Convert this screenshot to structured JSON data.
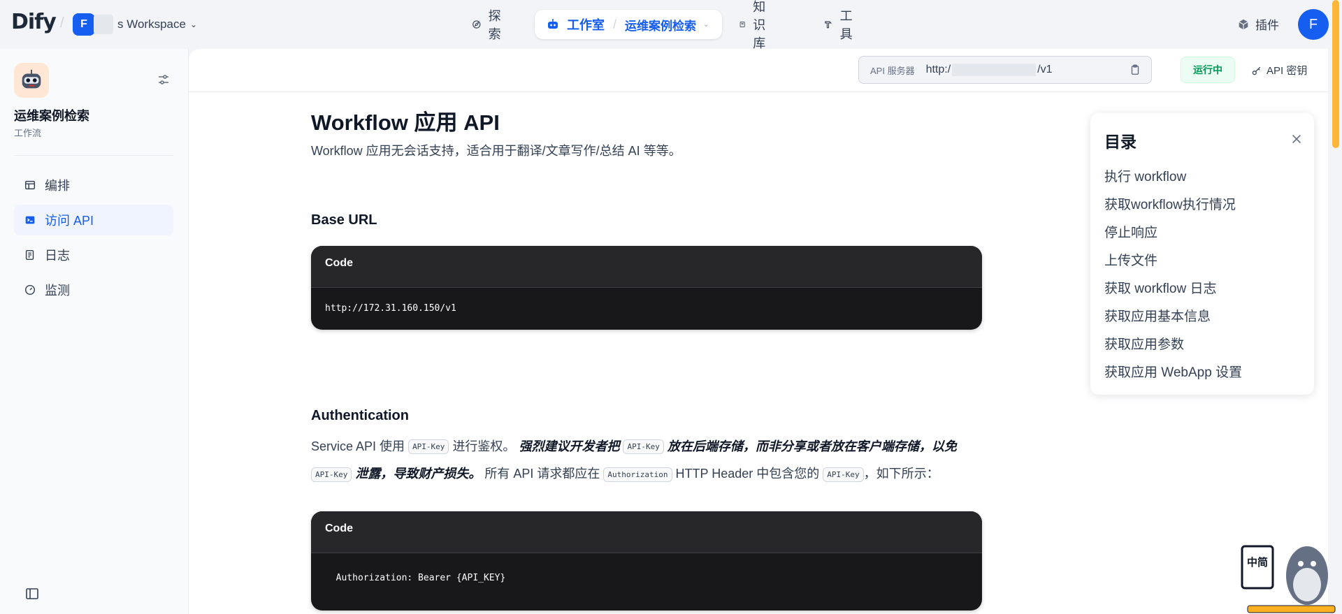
{
  "topbar": {
    "logo_main": "Dify",
    "workspace_badge": "F",
    "workspace_name": "s Workspace",
    "nav": {
      "explore": "探索",
      "studio": "工作室",
      "app_name": "运维案例检索",
      "knowledge": "知识库",
      "tools": "工具"
    },
    "plugins": "插件",
    "avatar": "F"
  },
  "sidebar": {
    "app_name": "运维案例检索",
    "app_type": "工作流",
    "items": [
      {
        "label": "编排",
        "icon": "layout-icon",
        "active": false
      },
      {
        "label": "访问 API",
        "icon": "terminal-icon",
        "active": true
      },
      {
        "label": "日志",
        "icon": "file-list-icon",
        "active": false
      },
      {
        "label": "监测",
        "icon": "dashboard-icon",
        "active": false
      }
    ]
  },
  "toolbar": {
    "api_server_label": "API 服务器",
    "api_server_prefix": "http:/",
    "api_server_suffix": "/v1",
    "status": "运行中",
    "api_key_button": "API 密钥"
  },
  "doc": {
    "title": "Workflow 应用 API",
    "lead": "Workflow 应用无会话支持，适合用于翻译/文章写作/总结 AI 等等。",
    "base_url_heading": "Base URL",
    "code_label": "Code",
    "base_url_code": "http://172.31.160.150/v1",
    "auth_heading": "Authentication",
    "auth_code": "  Authorization: Bearer {API_KEY}",
    "auth_para": {
      "p1": "Service API 使用",
      "c1": "API-Key",
      "p2": "进行鉴权。",
      "b1": "强烈建议开发者把",
      "c2": "API-Key",
      "b2": "放在后端存储，而非分享或者放在客户端存储，以免",
      "c3": "API-Key",
      "b3": "泄露，导致财产损失。",
      "p3": "所有 API 请求都应在",
      "c4": "Authorization",
      "p4": "HTTP Header 中包含您的",
      "c5": "API-Key",
      "p5": "，如下所示："
    }
  },
  "toc": {
    "title": "目录",
    "items": [
      "执行 workflow",
      "获取workflow执行情况",
      "停止响应",
      "上传文件",
      "获取 workflow 日志",
      "获取应用基本信息",
      "获取应用参数",
      "获取应用 WebApp 设置"
    ]
  },
  "mascot_text": "中简"
}
